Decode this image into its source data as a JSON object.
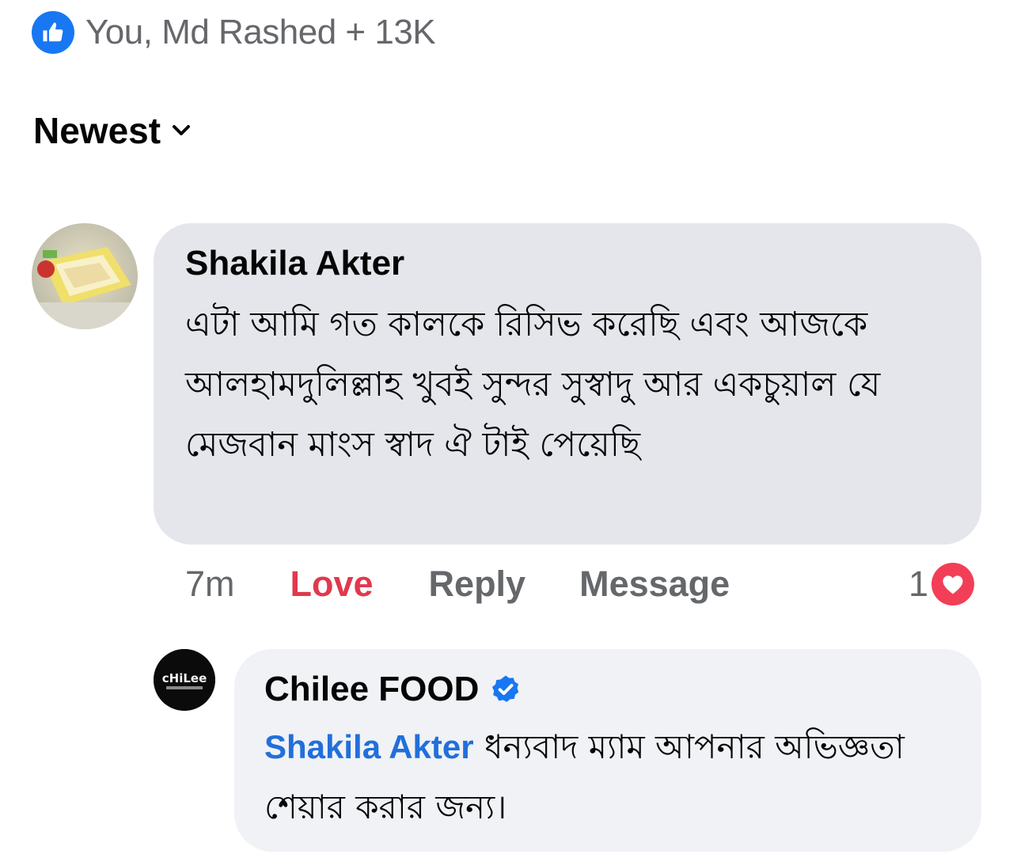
{
  "reactions": {
    "summary": "You, Md Rashed + 13K",
    "icon": "like-icon",
    "color": "#1877f2"
  },
  "sort": {
    "label": "Newest",
    "icon": "chevron-down-icon"
  },
  "comments": [
    {
      "author": "Shakila Akter",
      "text": "এটা আমি গত কালকে রিসিভ করেছি এবং আজকে আলহামদুলিল্লাহ খুবই সুন্দর সুস্বাদু আর একচুয়াল যে মেজবান মাংস স্বাদ ঐ টাই পেয়েছি",
      "time": "7m",
      "actions": {
        "love": "Love",
        "reply": "Reply",
        "message": "Message"
      },
      "reaction_count": "1",
      "reaction_icon": "heart-icon",
      "love_color": "#f33e58"
    }
  ],
  "reply": {
    "author": "Chilee FOOD",
    "avatar_text": "cHiLee",
    "verified_icon": "verified-badge-icon",
    "mention": "Shakila Akter",
    "text": "ধন্যবাদ ম্যাম আপনার অভিজ্ঞতা শেয়ার করার জন্য।",
    "mention_color": "#216fdb"
  }
}
